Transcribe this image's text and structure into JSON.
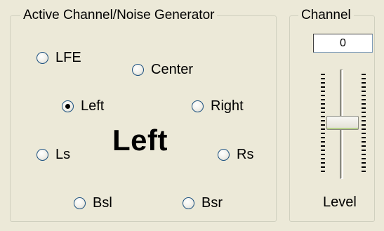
{
  "active_group": {
    "title": "Active Channel/Noise Generator",
    "channels": [
      {
        "label": "LFE",
        "checked": false
      },
      {
        "label": "Center",
        "checked": false
      },
      {
        "label": "Left",
        "checked": true
      },
      {
        "label": "Right",
        "checked": false
      },
      {
        "label": "Ls",
        "checked": false
      },
      {
        "label": "Rs",
        "checked": false
      },
      {
        "label": "Bsl",
        "checked": false
      },
      {
        "label": "Bsr",
        "checked": false
      }
    ],
    "active_channel_display": "Left"
  },
  "channel_group": {
    "title": "Channel",
    "value": "0",
    "level_label": "Level",
    "slider_fraction_from_top": 0.5
  }
}
